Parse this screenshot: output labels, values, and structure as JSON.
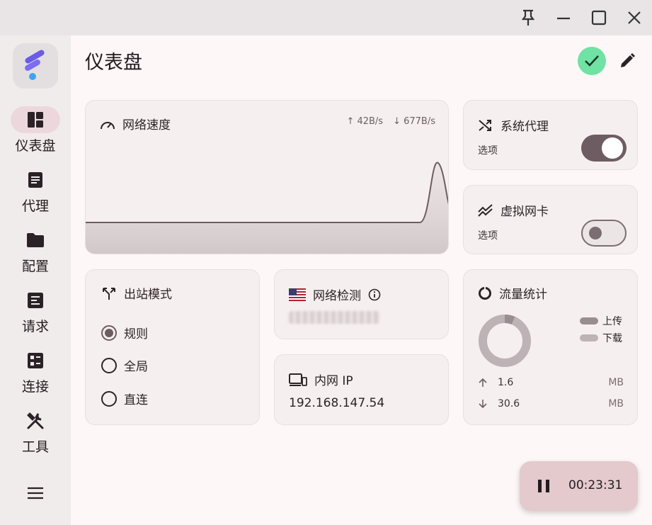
{
  "window": {
    "pin_icon": "pin-icon",
    "minimize_icon": "minimize-icon",
    "maximize_icon": "maximize-icon",
    "close_icon": "close-icon"
  },
  "sidebar": {
    "items": [
      {
        "label": "仪表盘",
        "icon": "dashboard-icon",
        "active": true
      },
      {
        "label": "代理",
        "icon": "proxy-icon"
      },
      {
        "label": "配置",
        "icon": "folder-icon"
      },
      {
        "label": "请求",
        "icon": "request-icon"
      },
      {
        "label": "连接",
        "icon": "connection-icon"
      },
      {
        "label": "工具",
        "icon": "tools-icon"
      }
    ]
  },
  "header": {
    "title": "仪表盘"
  },
  "speed": {
    "title": "网络速度",
    "upload": "↑ 42B/s",
    "download": "↓ 677B/s"
  },
  "system_proxy": {
    "title": "系统代理",
    "sub": "选项",
    "enabled": true
  },
  "tun": {
    "title": "虚拟网卡",
    "sub": "选项",
    "enabled": false
  },
  "outbound": {
    "title": "出站模式",
    "options": [
      {
        "label": "规则",
        "checked": true
      },
      {
        "label": "全局",
        "checked": false
      },
      {
        "label": "直连",
        "checked": false
      }
    ]
  },
  "network_check": {
    "title": "网络检测"
  },
  "intranet": {
    "title": "内网 IP",
    "ip": "192.168.147.54"
  },
  "traffic": {
    "title": "流量统计",
    "legend_upload": "上传",
    "legend_download": "下载",
    "upload_value": "1.6",
    "upload_unit": "MB",
    "download_value": "30.6",
    "download_unit": "MB",
    "upload_color": "#9a8d91",
    "download_color": "#bdb3b6"
  },
  "fab": {
    "time": "00:23:31"
  },
  "colors": {
    "accent": "#6d5d62",
    "ok": "#6fe2a4",
    "fab": "#e4c9cd"
  }
}
